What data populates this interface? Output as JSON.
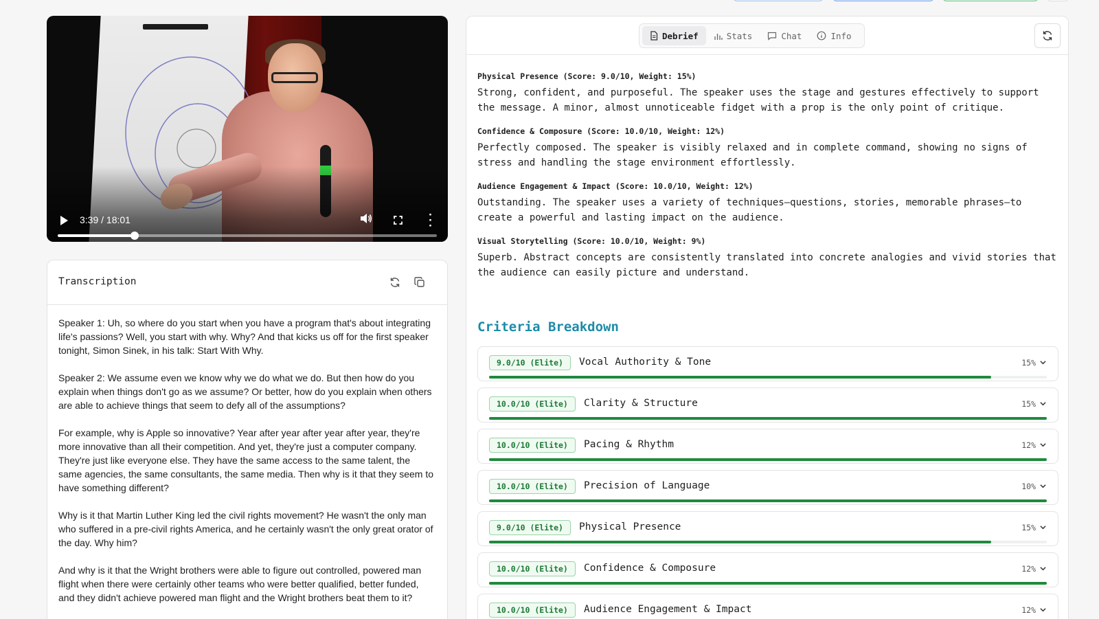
{
  "video": {
    "time": "3:39 / 18:01",
    "progress": 0.203
  },
  "transcription": {
    "title": "Transcription",
    "paragraphs": [
      "Speaker 1: Uh, so where do you start when you have a program that's about integrating life's passions? Well, you start with why. Why? And that kicks us off for the first speaker tonight, Simon Sinek, in his talk: Start With Why.",
      "Speaker 2: We assume even we know why we do what we do. But then how do you explain when things don't go as we assume? Or better, how do you explain when others are able to achieve things that seem to defy all of the assumptions?",
      "For example, why is Apple so innovative? Year after year after year after year, they're more innovative than all their competition. And yet, they're just a computer company. They're just like everyone else. They have the same access to the same talent, the same agencies, the same consultants, the same media. Then why is it that they seem to have something different?",
      "Why is it that Martin Luther King led the civil rights movement? He wasn't the only man who suffered in a pre-civil rights America, and he certainly wasn't the only great orator of the day. Why him?",
      "And why is it that the Wright brothers were able to figure out controlled, powered man flight when there were certainly other teams who were better qualified, better funded, and they didn't achieve powered man flight and the Wright brothers beat them to it?"
    ]
  },
  "tabs": [
    {
      "label": "Debrief",
      "icon": "document-icon",
      "active": true
    },
    {
      "label": "Stats",
      "icon": "bar-chart-icon",
      "active": false
    },
    {
      "label": "Chat",
      "icon": "chat-icon",
      "active": false
    },
    {
      "label": "Info",
      "icon": "info-icon",
      "active": false
    }
  ],
  "metrics": [
    {
      "title": "Physical Presence (Score: 9.0/10, Weight: 15%)",
      "text": "Strong, confident, and purposeful. The speaker uses the stage and gestures effectively to support the message. A minor, almost unnoticeable fidget with a prop is the only point of critique."
    },
    {
      "title": "Confidence & Composure (Score: 10.0/10, Weight: 12%)",
      "text": "Perfectly composed. The speaker is visibly relaxed and in complete command, showing no signs of stress and handling the stage environment effortlessly."
    },
    {
      "title": "Audience Engagement & Impact (Score: 10.0/10, Weight: 12%)",
      "text": "Outstanding. The speaker uses a variety of techniques—questions, stories, memorable phrases—to create a powerful and lasting impact on the audience."
    },
    {
      "title": "Visual Storytelling (Score: 10.0/10, Weight: 9%)",
      "text": "Superb. Abstract concepts are consistently translated into concrete analogies and vivid stories that the audience can easily picture and understand."
    }
  ],
  "criteria_title": "Criteria Breakdown",
  "criteria": [
    {
      "badge": "9.0/10 (Elite)",
      "name": "Vocal Authority & Tone",
      "weight": "15%",
      "score": 0.9
    },
    {
      "badge": "10.0/10 (Elite)",
      "name": "Clarity & Structure",
      "weight": "15%",
      "score": 1.0
    },
    {
      "badge": "10.0/10 (Elite)",
      "name": "Pacing & Rhythm",
      "weight": "12%",
      "score": 1.0
    },
    {
      "badge": "10.0/10 (Elite)",
      "name": "Precision of Language",
      "weight": "10%",
      "score": 1.0
    },
    {
      "badge": "9.0/10 (Elite)",
      "name": "Physical Presence",
      "weight": "15%",
      "score": 0.9
    },
    {
      "badge": "10.0/10 (Elite)",
      "name": "Confidence & Composure",
      "weight": "12%",
      "score": 1.0
    },
    {
      "badge": "10.0/10 (Elite)",
      "name": "Audience Engagement & Impact",
      "weight": "12%",
      "score": 1.0
    }
  ],
  "colors": {
    "accent": "#1d8ca8",
    "score_bar": "#1f8a3d",
    "badge_text": "#1b7a35"
  }
}
